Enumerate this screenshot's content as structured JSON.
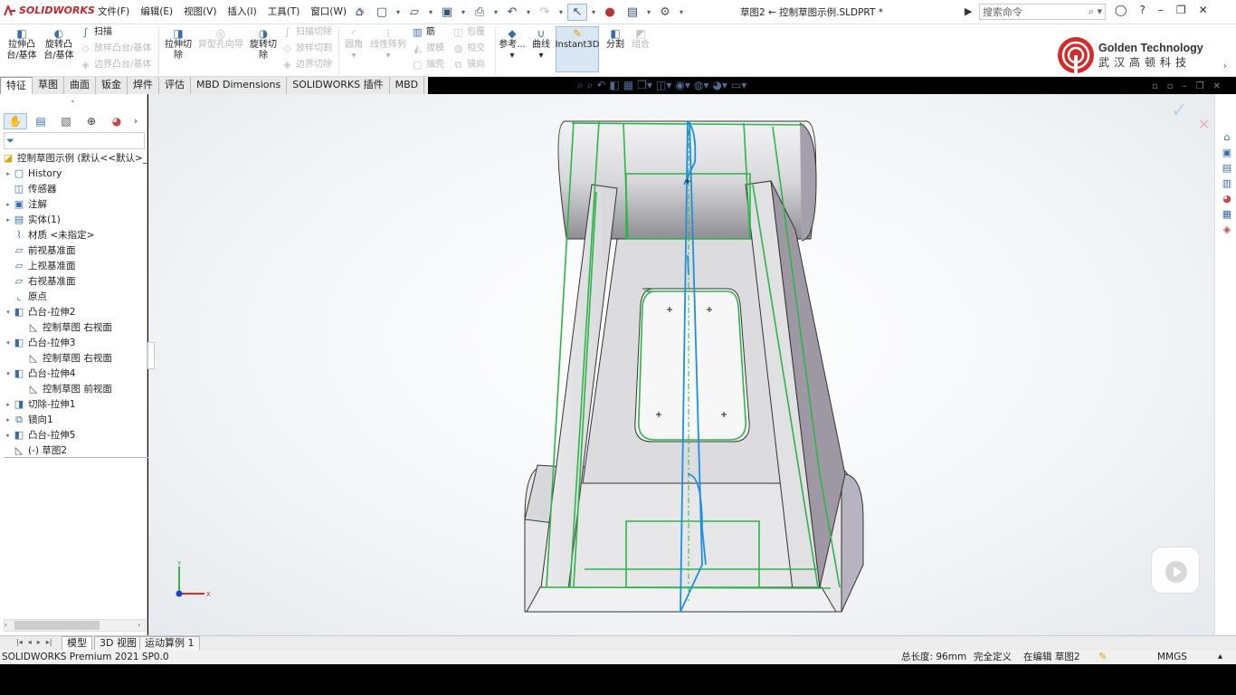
{
  "app": {
    "logo": "SOLIDWORKS",
    "doc_title": "草图2 ← 控制草图示例.SLDPRT *",
    "product": "SOLIDWORKS Premium 2021 SP0.0"
  },
  "menu": [
    "文件(F)",
    "编辑(E)",
    "视图(V)",
    "插入(I)",
    "工具(T)",
    "窗口(W)"
  ],
  "search": {
    "placeholder": "搜索命令"
  },
  "ribbon": {
    "extrude_boss": "拉伸凸台/基体",
    "revolve_boss": "旋转凸台/基体",
    "sweep": "扫描",
    "loft": "放样凸台/基体",
    "boundary_boss": "边界凸台/基体",
    "extrude_cut": "拉伸切除",
    "hole_wizard": "异型孔向导",
    "revolve_cut": "旋转切除",
    "swept_cut": "扫描切除",
    "lofted_cut": "放样切割",
    "boundary_cut": "边界切除",
    "fillet": "圆角",
    "linear_pattern": "线性阵列",
    "rib": "筋",
    "draft": "拔模",
    "shell": "抽壳",
    "wrap": "包覆",
    "intersect": "相交",
    "mirror": "镜向",
    "reference": "参考...",
    "curves": "曲线",
    "instant3d": "Instant3D",
    "split": "分割",
    "combine": "组合"
  },
  "brand": {
    "name": "Golden Technology",
    "cn": "武汉高顿科技",
    "color": "#d42a2a"
  },
  "tabs": [
    "特征",
    "草图",
    "曲面",
    "钣金",
    "焊件",
    "评估",
    "MBD Dimensions",
    "SOLIDWORKS 插件",
    "MBD"
  ],
  "tree": [
    {
      "label": "控制草图示例 (默认<<默认>_",
      "icon": "part-icon"
    },
    {
      "label": "History",
      "icon": "history-folder-icon"
    },
    {
      "label": "传感器",
      "icon": "sensor-icon"
    },
    {
      "label": "注解",
      "icon": "annotation-icon"
    },
    {
      "label": "实体(1)",
      "icon": "solid-body-icon"
    },
    {
      "label": "材质 <未指定>",
      "icon": "material-icon"
    },
    {
      "label": "前视基准面",
      "icon": "plane-icon"
    },
    {
      "label": "上视基准面",
      "icon": "plane-icon"
    },
    {
      "label": "右视基准面",
      "icon": "plane-icon"
    },
    {
      "label": "原点",
      "icon": "origin-icon"
    },
    {
      "label": "凸台-拉伸2",
      "icon": "boss-extrude-icon"
    },
    {
      "label": "控制草图 右视面",
      "icon": "sketch-icon"
    },
    {
      "label": "凸台-拉伸3",
      "icon": "boss-extrude-icon"
    },
    {
      "label": "控制草图 右视面",
      "icon": "sketch-icon"
    },
    {
      "label": "凸台-拉伸4",
      "icon": "boss-extrude-icon"
    },
    {
      "label": "控制草图 前视面",
      "icon": "sketch-icon"
    },
    {
      "label": "切除-拉伸1",
      "icon": "cut-extrude-icon"
    },
    {
      "label": "镜向1",
      "icon": "mirror-icon"
    },
    {
      "label": "凸台-拉伸5",
      "icon": "boss-extrude-icon"
    },
    {
      "label": "(-) 草图2",
      "icon": "sketch-icon"
    }
  ],
  "bottom_tabs": [
    "模型",
    "3D 视图",
    "运动算例 1"
  ],
  "status": {
    "total_length": "总长度: 96mm",
    "defined": "完全定义",
    "editing": "在编辑 草图2",
    "units": "MMGS"
  },
  "colors": {
    "sketch_green": "#2fb34a",
    "sketch_blue": "#1e8fe0",
    "brand_red": "#c4262e"
  }
}
